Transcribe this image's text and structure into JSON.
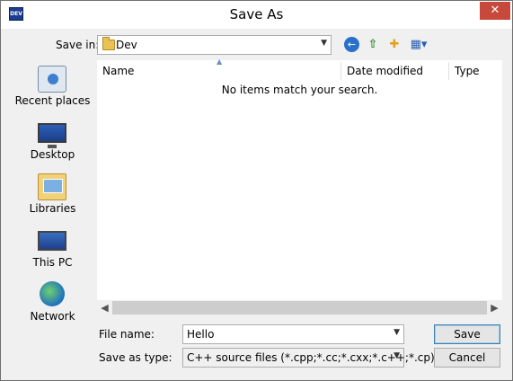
{
  "window": {
    "title": "Save As",
    "app_icon_text": "DEV",
    "close_glyph": "✕"
  },
  "toolbar": {
    "save_in_label": "Save in:",
    "save_in_value": "Dev",
    "combo_arrow": "▼",
    "icons": [
      "back-icon",
      "up-folder-icon",
      "new-folder-icon",
      "view-menu-icon"
    ]
  },
  "places": [
    {
      "label": "Recent places",
      "icon": "recent-places-icon"
    },
    {
      "label": "Desktop",
      "icon": "desktop-icon"
    },
    {
      "label": "Libraries",
      "icon": "libraries-icon"
    },
    {
      "label": "This PC",
      "icon": "this-pc-icon"
    },
    {
      "label": "Network",
      "icon": "network-icon"
    }
  ],
  "file_list": {
    "columns": [
      "Name",
      "Date modified",
      "Type"
    ],
    "empty_message": "No items match your search."
  },
  "form": {
    "file_name_label": "File name:",
    "file_name_value": "Hello",
    "save_as_type_label": "Save as type:",
    "save_as_type_value": "C++ source files (*.cpp;*.cc;*.cxx;*.c++;*.cp)"
  },
  "buttons": {
    "save": "Save",
    "cancel": "Cancel"
  },
  "colors": {
    "close_button": "#c7493b",
    "window_bg": "#f0f0f0",
    "accent": "#3c7fb1"
  }
}
